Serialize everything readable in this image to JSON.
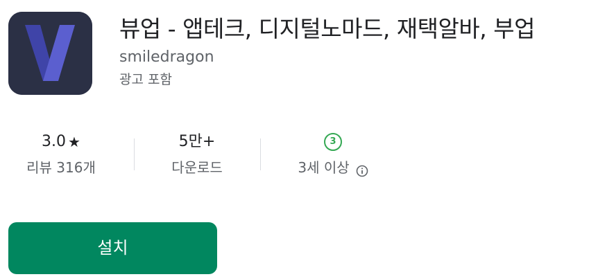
{
  "app": {
    "title": "뷰업 - 앱테크, 디지털노마드, 재택알바, 부업",
    "developer": "smiledragon",
    "ads_label": "광고 포함",
    "icon": "app-logo-v"
  },
  "stats": {
    "rating_value": "3.0",
    "rating_icon": "★",
    "reviews_label": "리뷰 316개",
    "downloads_value": "5만+",
    "downloads_label": "다운로드",
    "age_badge": "3",
    "age_label": "3세 이상",
    "age_info_icon": "info-icon"
  },
  "actions": {
    "install_label": "설치"
  },
  "colors": {
    "install_button": "#01875f",
    "age_badge": "#34a853",
    "icon_background": "#2b3045",
    "icon_glyph": "#5b5fcf",
    "secondary_text": "#5f6368"
  }
}
